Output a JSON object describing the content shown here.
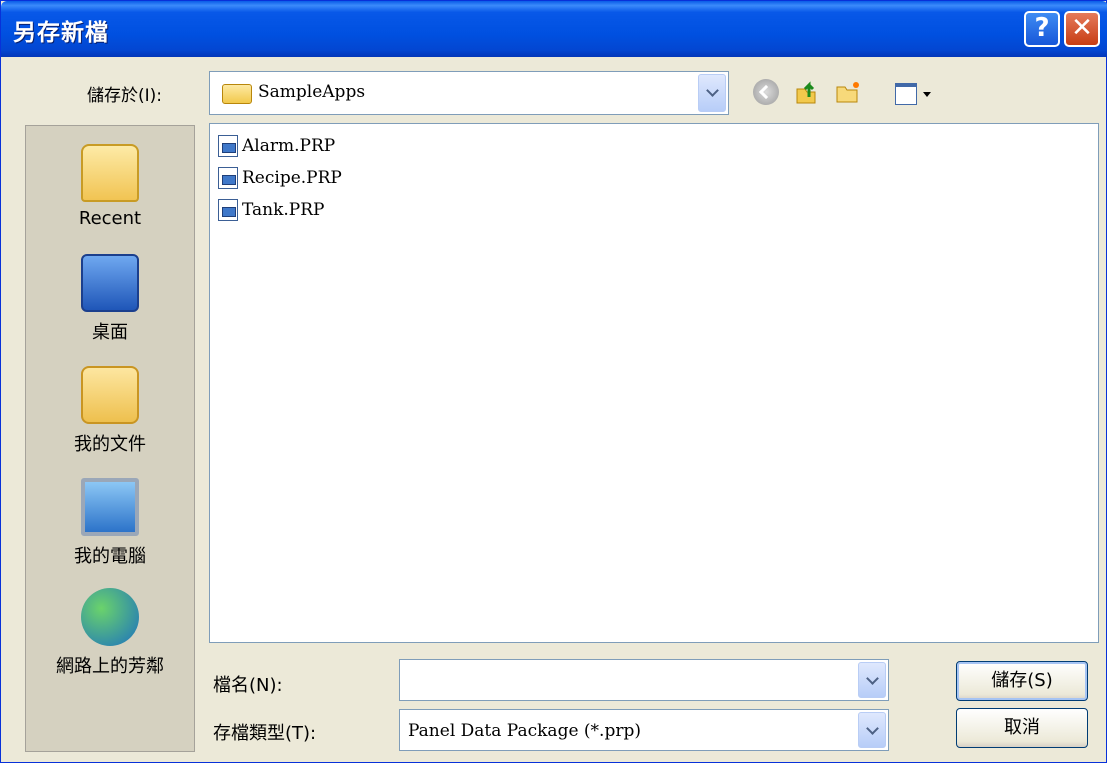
{
  "window": {
    "title": "另存新檔",
    "help_glyph": "?",
    "close_glyph": "✕"
  },
  "savein": {
    "label": "儲存於(I):",
    "folder": "SampleApps"
  },
  "places": [
    {
      "label": "Recent",
      "icon": "recent-folder-icon"
    },
    {
      "label": "桌面",
      "icon": "desktop-icon"
    },
    {
      "label": "我的文件",
      "icon": "my-documents-icon"
    },
    {
      "label": "我的電腦",
      "icon": "my-computer-icon"
    },
    {
      "label": "網路上的芳鄰",
      "icon": "network-places-icon"
    }
  ],
  "files": [
    {
      "name": "Alarm.PRP"
    },
    {
      "name": "Recipe.PRP"
    },
    {
      "name": "Tank.PRP"
    }
  ],
  "filename": {
    "label": "檔名(N):",
    "value": ""
  },
  "filetype": {
    "label": "存檔類型(T):",
    "value": "Panel Data Package (*.prp)"
  },
  "buttons": {
    "save": "儲存(S)",
    "cancel": "取消"
  }
}
